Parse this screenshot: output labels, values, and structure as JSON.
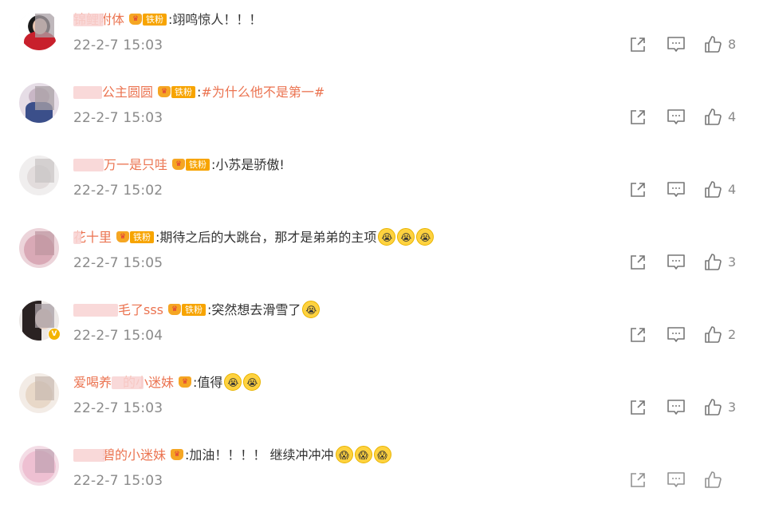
{
  "comments": [
    {
      "username": "锦鲤附体",
      "comment": ":翊鸣惊人！！！",
      "time": "22-2-7 15:03",
      "likes": "8",
      "badge": "铁粉"
    },
    {
      "username": "公主圆圆",
      "comment_prefix": ":",
      "topic": "#为什么他不是第一#",
      "time": "22-2-7 15:03",
      "likes": "4",
      "badge": "铁粉"
    },
    {
      "username": "万一是只哇",
      "comment": ":小苏是骄傲!",
      "time": "22-2-7 15:02",
      "likes": "4",
      "badge": "铁粉"
    },
    {
      "username": "花十里",
      "comment": ":期待之后的大跳台，那才是弟弟的主项",
      "time": "22-2-7 15:05",
      "likes": "3",
      "badge": "铁粉"
    },
    {
      "username": "毛了sss",
      "comment": ":突然想去滑雪了",
      "time": "22-2-7 15:04",
      "likes": "2",
      "badge": "铁粉"
    },
    {
      "username_a": "爱喝养",
      "username_b": "的小迷妹",
      "comment": ":值得",
      "time": "22-2-7 15:03",
      "likes": "3",
      "badge": ""
    },
    {
      "username": "碧的小迷妹",
      "comment": ":加油！！！！ 继续冲冲冲",
      "time": "22-2-7 15:03",
      "likes": "",
      "badge": ""
    }
  ],
  "icons": {
    "share": "share-icon",
    "comment": "comment-icon",
    "like": "thumbs-up-icon",
    "crown": "crown-icon",
    "emoji": "emoji-icon"
  },
  "colors": {
    "username": "#eb7350",
    "text": "#333333",
    "meta": "#8a8a8a",
    "badge": "#f7a400"
  }
}
